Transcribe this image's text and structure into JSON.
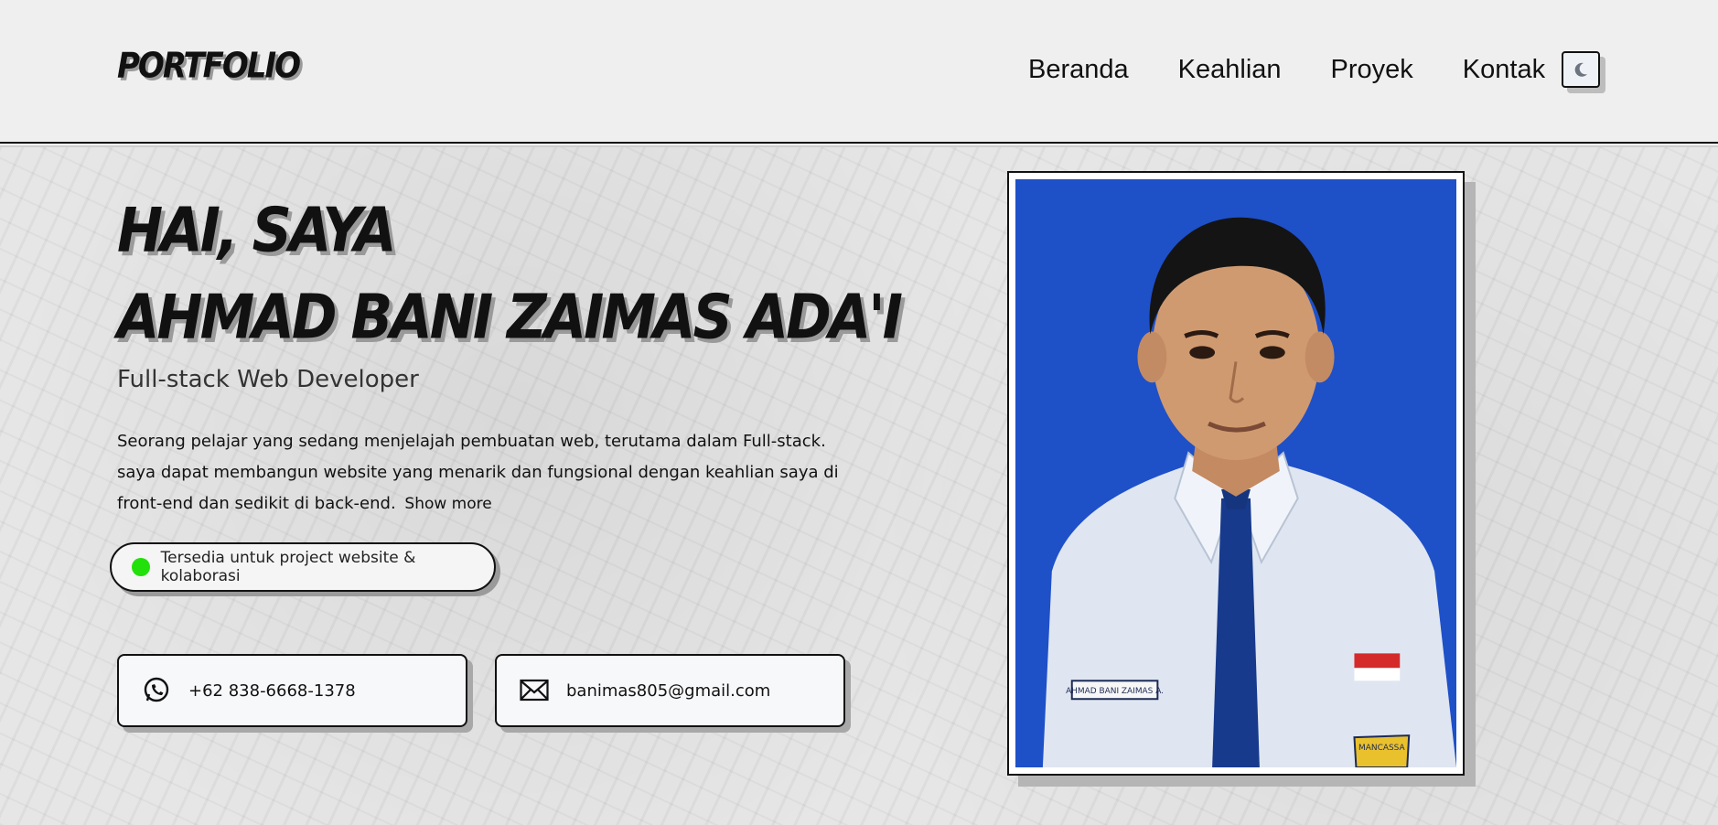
{
  "header": {
    "logo": "PORTFOLIO",
    "nav": [
      "Beranda",
      "Keahlian",
      "Proyek",
      "Kontak"
    ],
    "theme_icon": "moon-icon"
  },
  "hero": {
    "greeting_line1": "HAI, SAYA",
    "greeting_line2": "AHMAD BANI ZAIMAS ADA'I",
    "role": "Full-stack Web Developer",
    "description": "Seorang pelajar yang sedang menjelajah pembuatan web, terutama dalam Full-stack. saya dapat membangun website yang menarik dan fungsional dengan keahlian saya di front-end dan sedikit di back-end.",
    "show_more": "Show more",
    "availability": "Tersedia untuk project website & kolaborasi",
    "availability_color": "#22e00a"
  },
  "contacts": {
    "phone": "+62 838-6668-1378",
    "phone_icon": "whatsapp-icon",
    "email": "banimas805@gmail.com",
    "email_icon": "mail-icon"
  },
  "photo": {
    "background_color": "#1e50c8",
    "name_tag": "AHMAD BANI ZAIMAS A.",
    "badge_text": "MANCASSA"
  }
}
